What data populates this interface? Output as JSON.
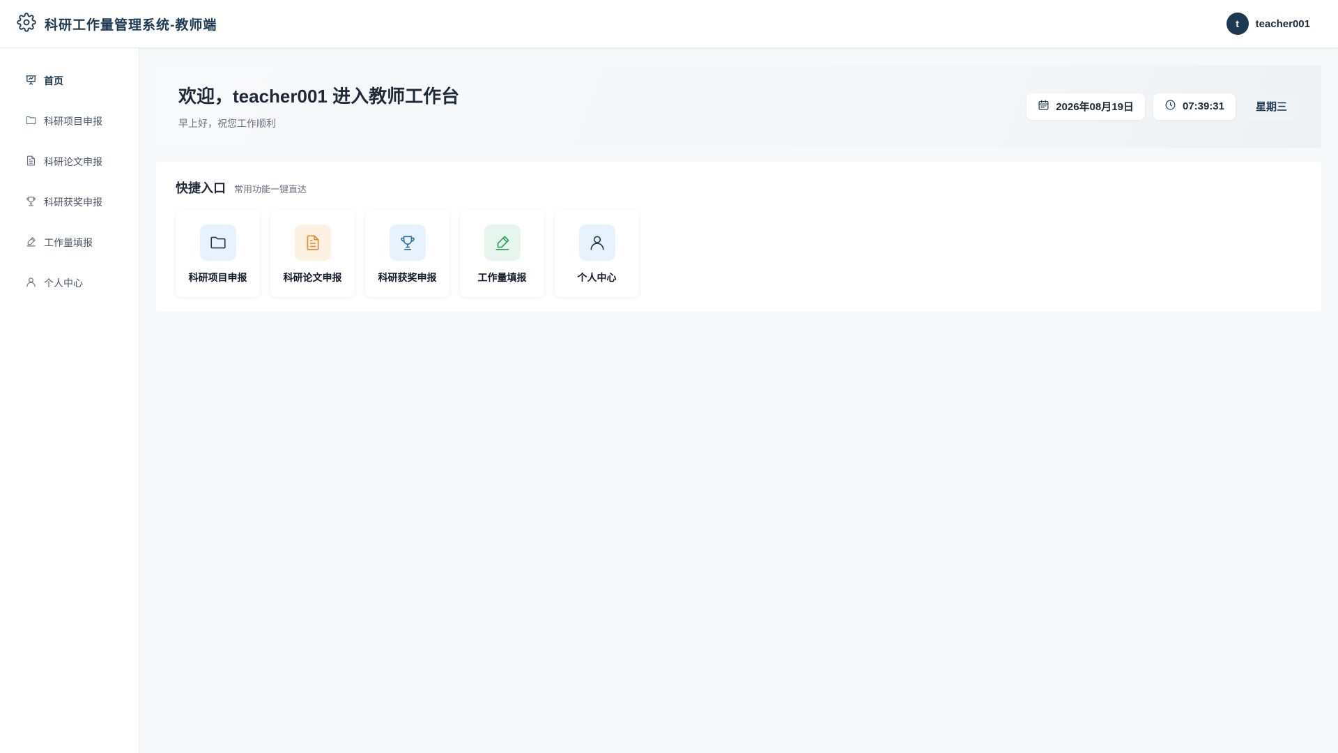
{
  "header": {
    "title": "科研工作量管理系统-教师端",
    "logo_icon": "gear-icon",
    "user": {
      "avatar_letter": "t",
      "name": "teacher001"
    }
  },
  "sidebar": {
    "items": [
      {
        "label": "首页",
        "icon": "presentation-chart-icon",
        "active": true
      },
      {
        "label": "科研项目申报",
        "icon": "folder-icon",
        "active": false
      },
      {
        "label": "科研论文申报",
        "icon": "document-icon",
        "active": false
      },
      {
        "label": "科研获奖申报",
        "icon": "trophy-icon",
        "active": false
      },
      {
        "label": "工作量填报",
        "icon": "pen-icon",
        "active": false
      },
      {
        "label": "个人中心",
        "icon": "user-icon",
        "active": false
      }
    ]
  },
  "welcome": {
    "title": "欢迎，teacher001 进入教师工作台",
    "subtitle": "早上好，祝您工作顺利",
    "date": "2026年08月19日",
    "time": "07:39:31",
    "weekday": "星期三"
  },
  "quick_access": {
    "title": "快捷入口",
    "subtitle": "常用功能一键直达",
    "cards": [
      {
        "label": "科研项目申报",
        "icon": "folder-icon",
        "color": "#1e3a52",
        "bg": "#e8f2fc"
      },
      {
        "label": "科研论文申报",
        "icon": "document-icon",
        "color": "#e8892b",
        "bg": "#fdf1e3"
      },
      {
        "label": "科研获奖申报",
        "icon": "trophy-icon",
        "color": "#2f6f9a",
        "bg": "#e8f2fc"
      },
      {
        "label": "工作量填报",
        "icon": "pen-icon",
        "color": "#2e9e5b",
        "bg": "#e6f6ec"
      },
      {
        "label": "个人中心",
        "icon": "user-icon",
        "color": "#1e3a52",
        "bg": "#e8f2fc"
      }
    ]
  },
  "colors": {
    "primary": "#1e3a52",
    "background": "#f7f8fa"
  }
}
